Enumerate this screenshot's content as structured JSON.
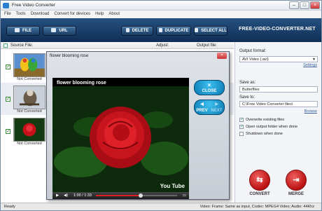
{
  "window": {
    "title": "Free Video Converter"
  },
  "menu": [
    "File",
    "Tools",
    "Download",
    "Convert for devices",
    "Help",
    "About"
  ],
  "toolbar": {
    "file": "FILE",
    "url": "URL",
    "delete": "DELETE",
    "duplicate": "DUPLICATE",
    "select_all": "SELECT ALL",
    "brand": "FREE-VIDEO-CONVERTER.NET"
  },
  "list_header": {
    "source": "Source File:",
    "adjust": "Adjust:",
    "output": "Output file:"
  },
  "files": [
    {
      "status": "Not Converted",
      "thumb_icon": "parrots-thumbnail"
    },
    {
      "status": "Not Converted",
      "thumb_icon": "hawk-thumbnail"
    },
    {
      "status": "Not Converted",
      "thumb_icon": "rose-thumbnail"
    }
  ],
  "player": {
    "title": "flower blooming rose",
    "video_title": "flower blooming rose",
    "close": "CLOSE",
    "prev": "PREV",
    "next": "NEXT",
    "time": "1:00 / 1:33",
    "logo": "You Tube",
    "progress": 0.55
  },
  "settings": {
    "output_format_label": "Output format:",
    "output_format_value": "AVI Video (.avi)",
    "settings_link": "Settings",
    "save_as_label": "Save as:",
    "save_as_value": "Butterflies",
    "save_to_label": "Save to:",
    "save_to_value": "C:\\Free Video Converter files\\",
    "browse_link": "Browse",
    "overwrite": "Overwrite existing files",
    "open_folder": "Open output folder when done",
    "shutdown": "Shutdown when done",
    "convert": "CONVERT",
    "merge": "MERGE"
  },
  "status": {
    "left": "Ready",
    "right": "Video: Frame: Same as input, Codec: MPEG4 Video; Audio: 44Khz"
  },
  "colors": {
    "toolbar": "#1b3e66",
    "accent": "#c41a1a",
    "player_button": "#1a9ad6"
  }
}
